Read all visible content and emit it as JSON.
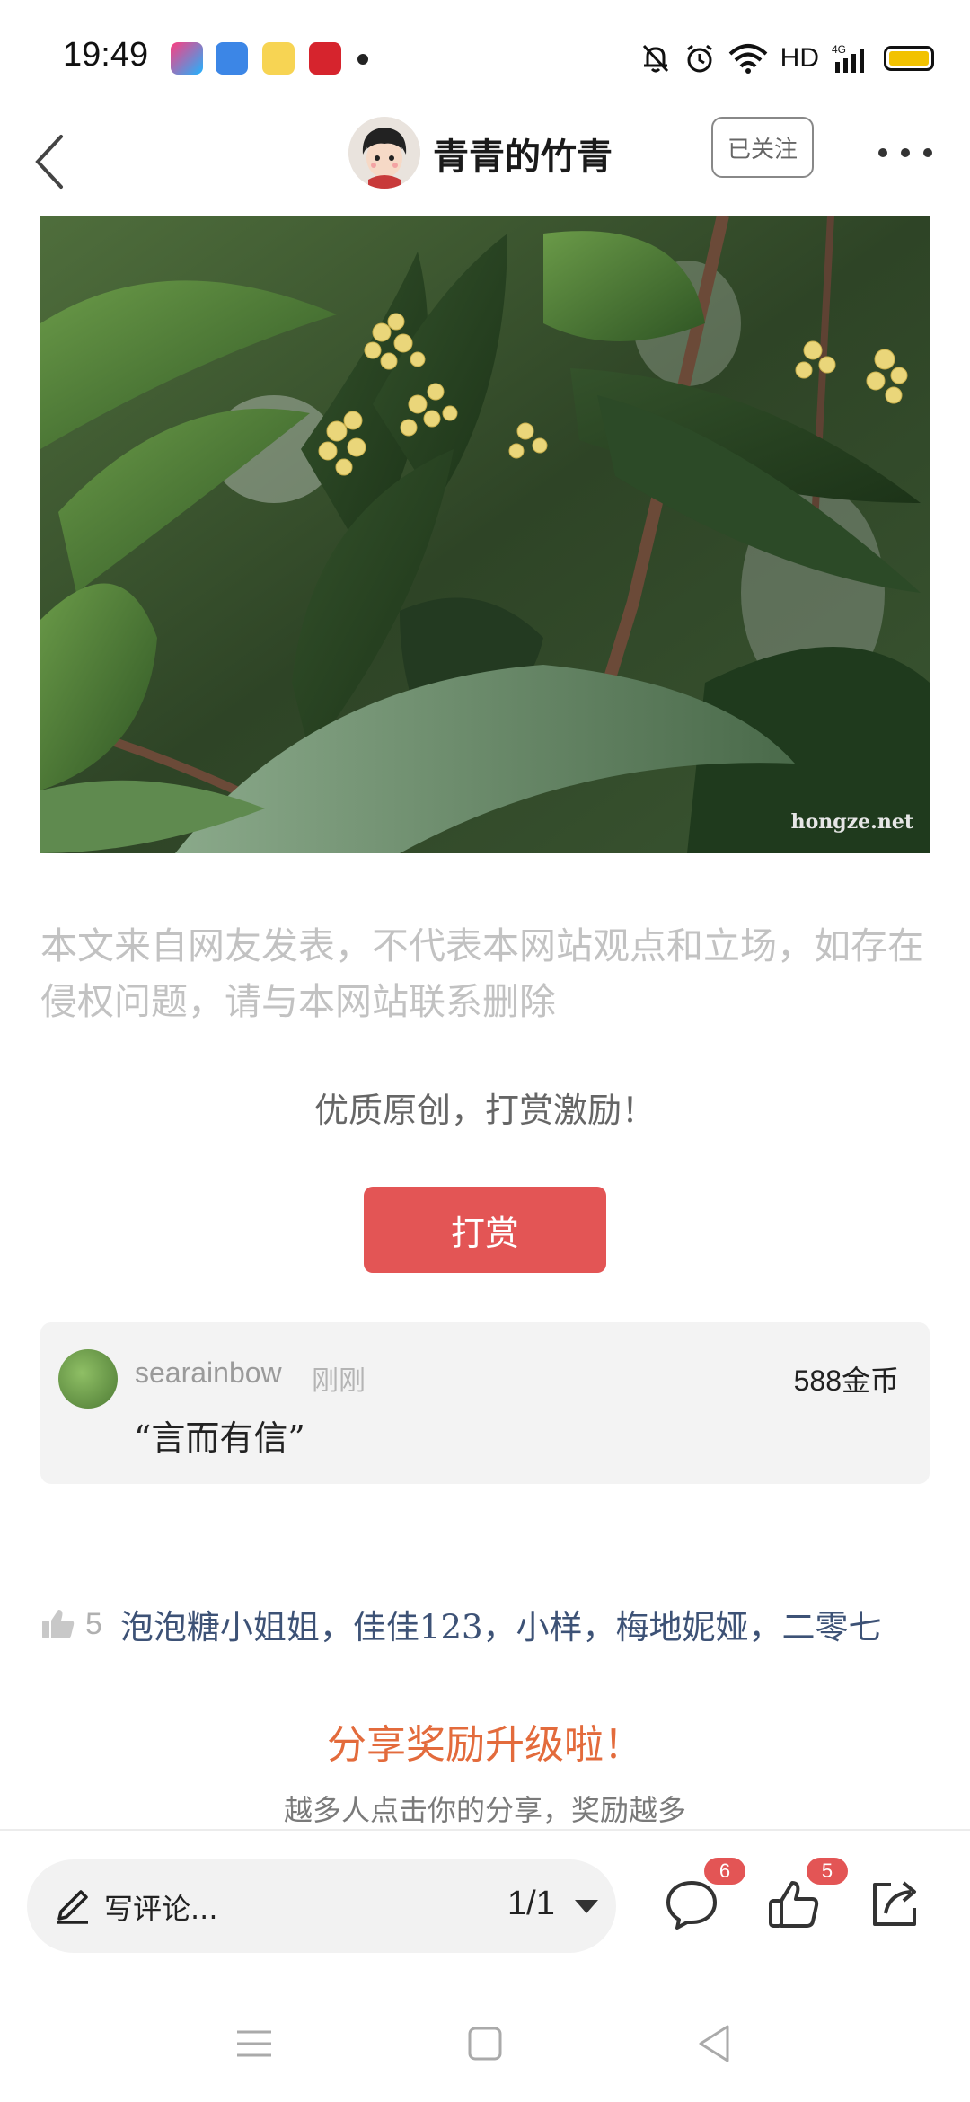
{
  "status_bar": {
    "time": "19:49",
    "network": "HD",
    "cell": "4G"
  },
  "header": {
    "author": "青青的竹青",
    "follow_label": "已关注"
  },
  "photo": {
    "watermark": "hongze.net"
  },
  "article": {
    "disclaimer": "本文来自网友发表，不代表本网站观点和立场，如存在侵权问题，请与本网站联系删除",
    "reward_note": "优质原创，打赏激励！",
    "reward_button": "打赏"
  },
  "reward_record": {
    "user": "searainbow",
    "time": "刚刚",
    "coins": "588金币",
    "quote": "“言而有信”"
  },
  "likes": {
    "count": "5",
    "names": "泡泡糖小姐姐，佳佳123，小样，梅地妮娅，二零七"
  },
  "share": {
    "title": "分享奖励升级啦！",
    "subtitle": "越多人点击你的分享，奖励越多"
  },
  "bottom_bar": {
    "comment_placeholder": "写评论...",
    "page_indicator": "1/1",
    "comment_badge": "6",
    "like_badge": "5"
  },
  "colors": {
    "accent_red": "#e35555",
    "share_orange": "#e36b3c",
    "link_blue": "#3d5276"
  }
}
